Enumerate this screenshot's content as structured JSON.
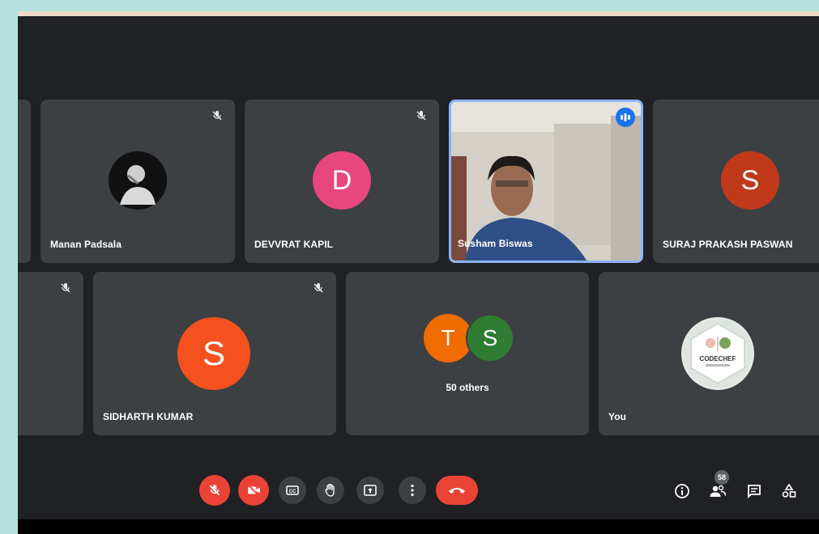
{
  "participants": [
    {
      "name": "Manan Padsala"
    },
    {
      "name": "DEVVRAT KAPIL",
      "initial": "D"
    },
    {
      "name": "Susham Biswas"
    },
    {
      "name": "SURAJ PRAKASH PASWAN",
      "initial": "S"
    },
    {
      "name": "SIDHARTH KUMAR",
      "initial": "S"
    },
    {
      "name": "You"
    }
  ],
  "others": {
    "initials": [
      "T",
      "S"
    ],
    "label": "50 others"
  },
  "logo_text": "CODECHEF",
  "participants_count": "58",
  "colors": {
    "tile": "#3c4043",
    "background": "#202124",
    "red": "#ea4335",
    "devvrat": "#e8477e",
    "suraj": "#c0391b",
    "sidharth": "#f4511e",
    "others_t": "#ef6c00",
    "others_s": "#2e7d32",
    "speaking": "#8ab4f8"
  },
  "controls": [
    "mic-off",
    "camera-off",
    "captions",
    "raise-hand",
    "present",
    "more-options",
    "leave-call"
  ],
  "side_icons": [
    "info",
    "people",
    "chat",
    "activities"
  ]
}
